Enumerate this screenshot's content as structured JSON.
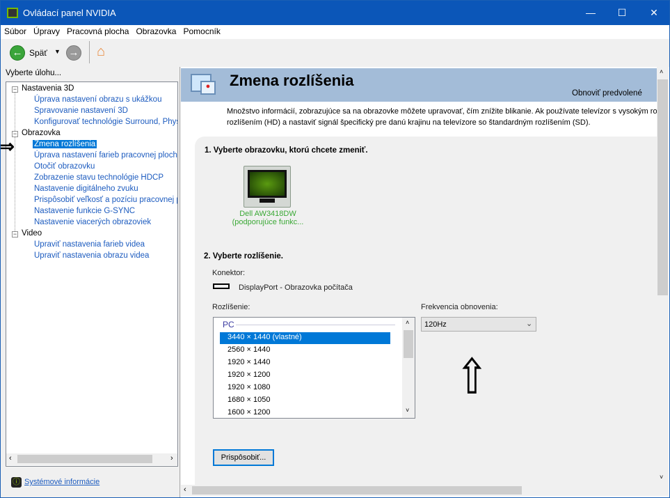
{
  "window": {
    "title": "Ovládací panel NVIDIA",
    "minimize": "—",
    "maximize": "☐",
    "close": "✕"
  },
  "menu": [
    "Súbor",
    "Úpravy",
    "Pracovná plocha",
    "Obrazovka",
    "Pomocník"
  ],
  "toolbar": {
    "back_label": "Späť"
  },
  "sidebar": {
    "heading": "Vyberte úlohu...",
    "groups": [
      {
        "label": "Nastavenia 3D",
        "items": [
          "Úprava nastavení obrazu s ukážkou",
          "Spravovanie nastavení 3D",
          "Konfigurovať technológie Surround, PhysX"
        ]
      },
      {
        "label": "Obrazovka",
        "items": [
          "Zmena rozlíšenia",
          "Úprava nastavení farieb pracovnej plochy",
          "Otočiť obrazovku",
          "Zobrazenie stavu technológie HDCP",
          "Nastavenie digitálneho zvuku",
          "Prispôsobiť veľkosť a pozíciu pracovnej plo",
          "Nastavenie funkcie G-SYNC",
          "Nastavenie viacerých obrazoviek"
        ]
      },
      {
        "label": "Video",
        "items": [
          "Upraviť nastavenia farieb videa",
          "Upraviť nastavenia obrazu videa"
        ]
      }
    ],
    "selected": "Zmena rozlíšenia",
    "system_info": "Systémové informácie"
  },
  "main": {
    "title": "Zmena rozlíšenia",
    "restore": "Obnoviť predvolené",
    "description_1": "Množstvo informácií, zobrazujúce sa na obrazovke môžete upravovať, čím znížite blikanie. Ak používate televízor s vysokým rozlíš",
    "description_2": "rozlíšením (HD) a nastaviť signál špecifický pre danú krajinu na televízore so štandardným rozlíšením (SD).",
    "step1": "1. Vyberte obrazovku, ktorú chcete zmeniť.",
    "monitor_name_1": "Dell AW3418DW",
    "monitor_name_2": "(podporujúce funkc...",
    "step2": "2. Vyberte rozlíšenie.",
    "connector_label": "Konektor:",
    "connector_value": "DisplayPort - Obrazovka počítača",
    "resolution_label": "Rozlíšenie:",
    "resolution_group": "PC",
    "resolutions": [
      "3440 × 1440 (vlastné)",
      "2560 × 1440",
      "1920 × 1440",
      "1920 × 1200",
      "1920 × 1080",
      "1680 × 1050",
      "1600 × 1200"
    ],
    "selected_resolution": "3440 × 1440 (vlastné)",
    "refresh_label": "Frekvencia obnovenia:",
    "refresh_value": "120Hz",
    "customize": "Prispôsobiť..."
  },
  "colors": {
    "titlebar": "#0b56b8",
    "header": "#a3bcd8",
    "link": "#1c5bbf",
    "selection": "#0078d7",
    "nvidia_green": "#76b900"
  }
}
